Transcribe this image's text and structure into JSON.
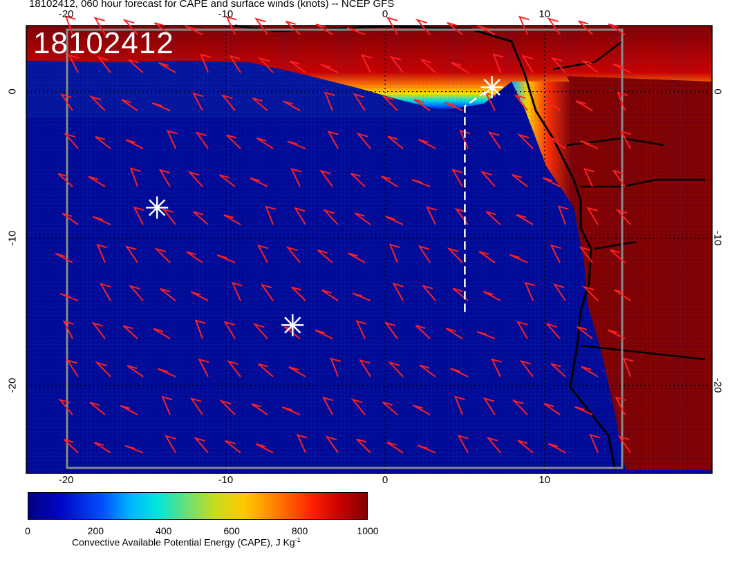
{
  "title": "18102412, 060 hour forecast for CAPE and surface winds (knots) -- NCEP GFS",
  "date_label": "18102412",
  "map": {
    "lon_range": [
      -22.5,
      20.5
    ],
    "lat_range": [
      -26,
      4.5
    ],
    "lon_ticks_top": [
      "-20",
      "-10",
      "0",
      "10"
    ],
    "lon_ticks_bottom": [
      "-20",
      "-10",
      "0",
      "10"
    ],
    "lat_ticks_left": [
      "0",
      "-10",
      "-20"
    ],
    "lat_ticks_right": [
      "0",
      "-10",
      "-20"
    ],
    "markers": [
      {
        "name": "storm-marker-1",
        "lon": -14.3,
        "lat": -7.9
      },
      {
        "name": "storm-marker-2",
        "lon": -5.8,
        "lat": -15.9
      },
      {
        "name": "storm-marker-3",
        "lon": 6.7,
        "lat": 0.3
      }
    ],
    "track": [
      [
        5,
        -15
      ],
      [
        5,
        -1
      ],
      [
        6.3,
        0
      ]
    ],
    "colors": {
      "wind_barb": "#ff2020",
      "coast": "#000000",
      "marker": "#ffffff",
      "ocean_low": "#000090",
      "land_high": "#800000"
    }
  },
  "colorbar": {
    "ticks": [
      "0",
      "200",
      "400",
      "600",
      "800",
      "1000"
    ],
    "label_prefix": "Convective Available Potential Energy (CAPE), J Kg",
    "label_exp": "-1"
  }
}
